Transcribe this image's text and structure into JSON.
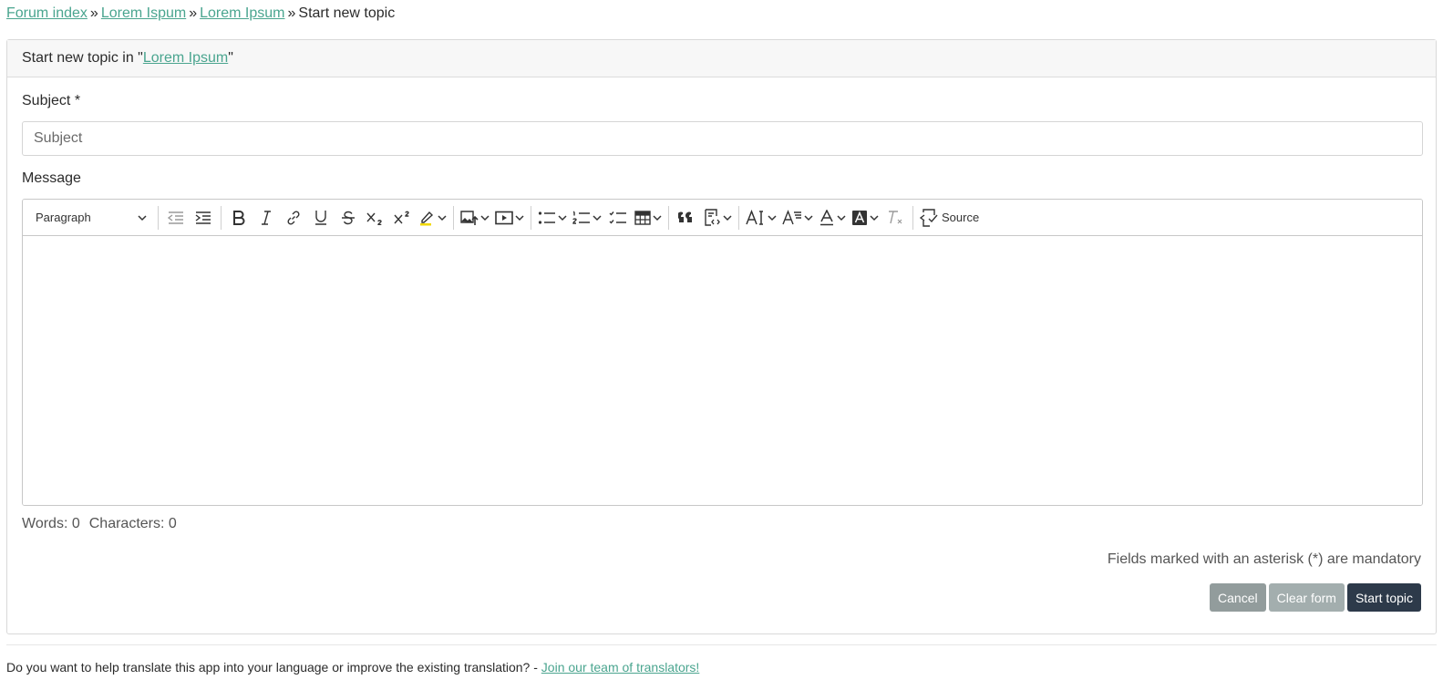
{
  "breadcrumb": {
    "items": [
      "Forum index",
      "Lorem Ispum",
      "Lorem Ipsum"
    ],
    "separator": "»",
    "current": "Start new topic"
  },
  "card": {
    "header_prefix": "Start new topic in \"",
    "header_link": "Lorem Ipsum",
    "header_suffix": "\""
  },
  "form": {
    "subject_label": "Subject *",
    "subject_placeholder": "Subject",
    "subject_value": "",
    "message_label": "Message"
  },
  "editor": {
    "paragraph_label": "Paragraph",
    "source_label": "Source",
    "icons": [
      "outdent-icon",
      "indent-icon",
      "bold-icon",
      "italic-icon",
      "link-icon",
      "underline-icon",
      "strikethrough-icon",
      "subscript-icon",
      "superscript-icon",
      "highlight-icon",
      "insert-image-icon",
      "media-embed-icon",
      "bulleted-list-icon",
      "numbered-list-icon",
      "todo-list-icon",
      "table-icon",
      "blockquote-icon",
      "code-block-icon",
      "font-size-icon",
      "font-family-icon",
      "font-color-icon",
      "font-background-icon",
      "remove-format-icon",
      "source-icon"
    ]
  },
  "counts": {
    "words": "Words: 0",
    "characters": "Characters: 0"
  },
  "notice": "Fields marked with an asterisk (*) are mandatory",
  "actions": {
    "cancel": "Cancel",
    "clear": "Clear form",
    "start": "Start topic"
  },
  "footer": {
    "text": "Do you want to help translate this app into your language or improve the existing translation? - ",
    "link": "Join our team of translators!"
  },
  "colors": {
    "link": "#4aa58f",
    "primary_button": "#2d3a4a",
    "secondary_button": "#929c9c"
  }
}
